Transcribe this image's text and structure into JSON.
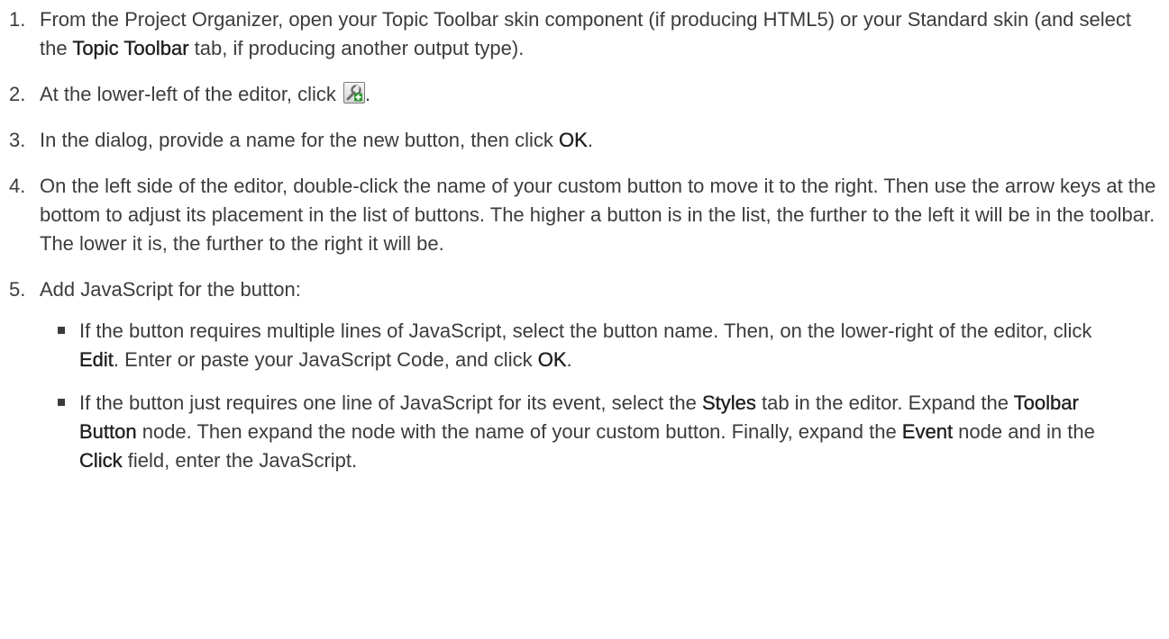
{
  "steps": [
    {
      "number": "1.",
      "parts": {
        "a": "From the Project Organizer, open your Topic Toolbar skin component (if producing HTML5) or your Standard skin (and select the ",
        "b": "Topic Toolbar",
        "c": " tab, if producing another output type)."
      }
    },
    {
      "number": "2.",
      "parts": {
        "a": "At the lower-left of the editor, click ",
        "c": "."
      },
      "icon": "add-toolbar-button-icon"
    },
    {
      "number": "3.",
      "parts": {
        "a": "In the dialog, provide a name for the new button, then click ",
        "b": "OK",
        "c": "."
      }
    },
    {
      "number": "4.",
      "text": "On the left side of the editor, double-click the name of your custom button to move it to the right. Then use the arrow keys at the bottom to adjust its placement in the list of buttons. The higher a button is in the list, the further to the left it will be in the toolbar. The lower it is, the further to the right it will be."
    },
    {
      "number": "5.",
      "text": "Add JavaScript for the button:",
      "sub": [
        {
          "a": "If the button requires multiple lines of JavaScript, select the button name. Then, on the lower-right of the editor, click ",
          "b": "Edit",
          "c": ". Enter or paste your JavaScript Code, and click ",
          "d": "OK",
          "e": "."
        },
        {
          "a": "If the button just requires one line of JavaScript for its event, select the ",
          "b": "Styles",
          "c": " tab in the editor. Expand the ",
          "d": "Toolbar Button",
          "e": " node. Then expand the node with the name of your custom button. Finally, expand the ",
          "f": "Event",
          "g": " node and in the ",
          "h": "Click",
          "i": " field, enter the JavaScript."
        }
      ]
    }
  ]
}
